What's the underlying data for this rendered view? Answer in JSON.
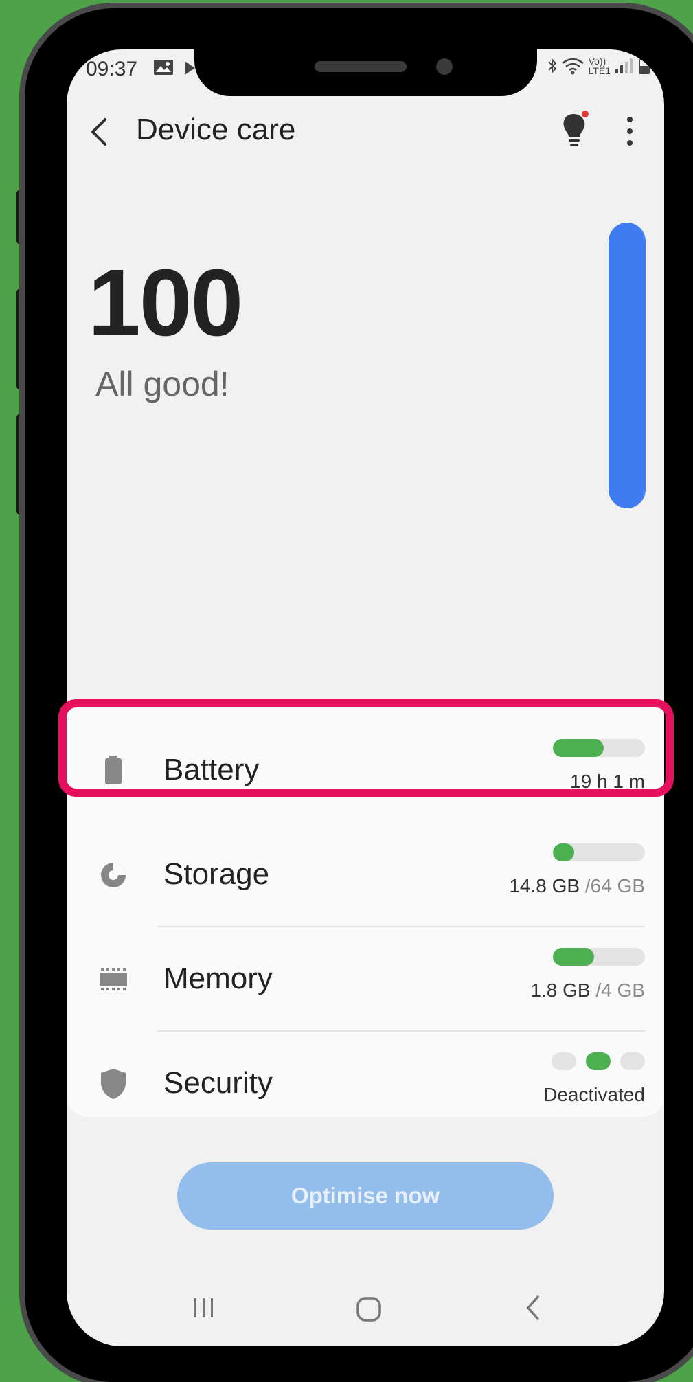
{
  "status_bar": {
    "time": "09:37",
    "left_icons": [
      "image-icon",
      "play-store-icon"
    ],
    "right_icons": [
      "bluetooth-icon",
      "wifi-icon",
      "volte-icon",
      "signal-icon",
      "battery-icon"
    ],
    "volte_label": "Vo))",
    "lte_label": "LTE1"
  },
  "app_bar": {
    "title": "Device care",
    "back_icon": "chevron-left-icon",
    "tips_icon": "lightbulb-icon",
    "more_icon": "more-vert-icon"
  },
  "summary": {
    "score": "100",
    "message": "All good!",
    "score_fraction": 1.0,
    "accent_color": "#3f7cf2"
  },
  "items": [
    {
      "id": "battery",
      "label": "Battery",
      "icon": "battery-icon",
      "value": "19 h 1 m",
      "meter_fraction": 0.55,
      "highlighted": true
    },
    {
      "id": "storage",
      "label": "Storage",
      "icon": "pie-chart-icon",
      "value": "14.8 GB",
      "value_total": " /64 GB",
      "meter_fraction": 0.23
    },
    {
      "id": "memory",
      "label": "Memory",
      "icon": "memory-chip-icon",
      "value": "1.8 GB",
      "value_total": " /4 GB",
      "meter_fraction": 0.45
    },
    {
      "id": "security",
      "label": "Security",
      "icon": "shield-icon",
      "value": "Deactivated",
      "active_dot_index": 1,
      "dot_count": 3
    }
  ],
  "colors": {
    "meter_fill": "#4caf50",
    "highlight_border": "#e5105e",
    "button_bg": "#93bdea"
  },
  "action": {
    "label": "Optimise now"
  },
  "nav_bar": {
    "recent_icon": "recent-apps-icon",
    "home_icon": "home-icon",
    "back_icon": "back-nav-icon"
  }
}
